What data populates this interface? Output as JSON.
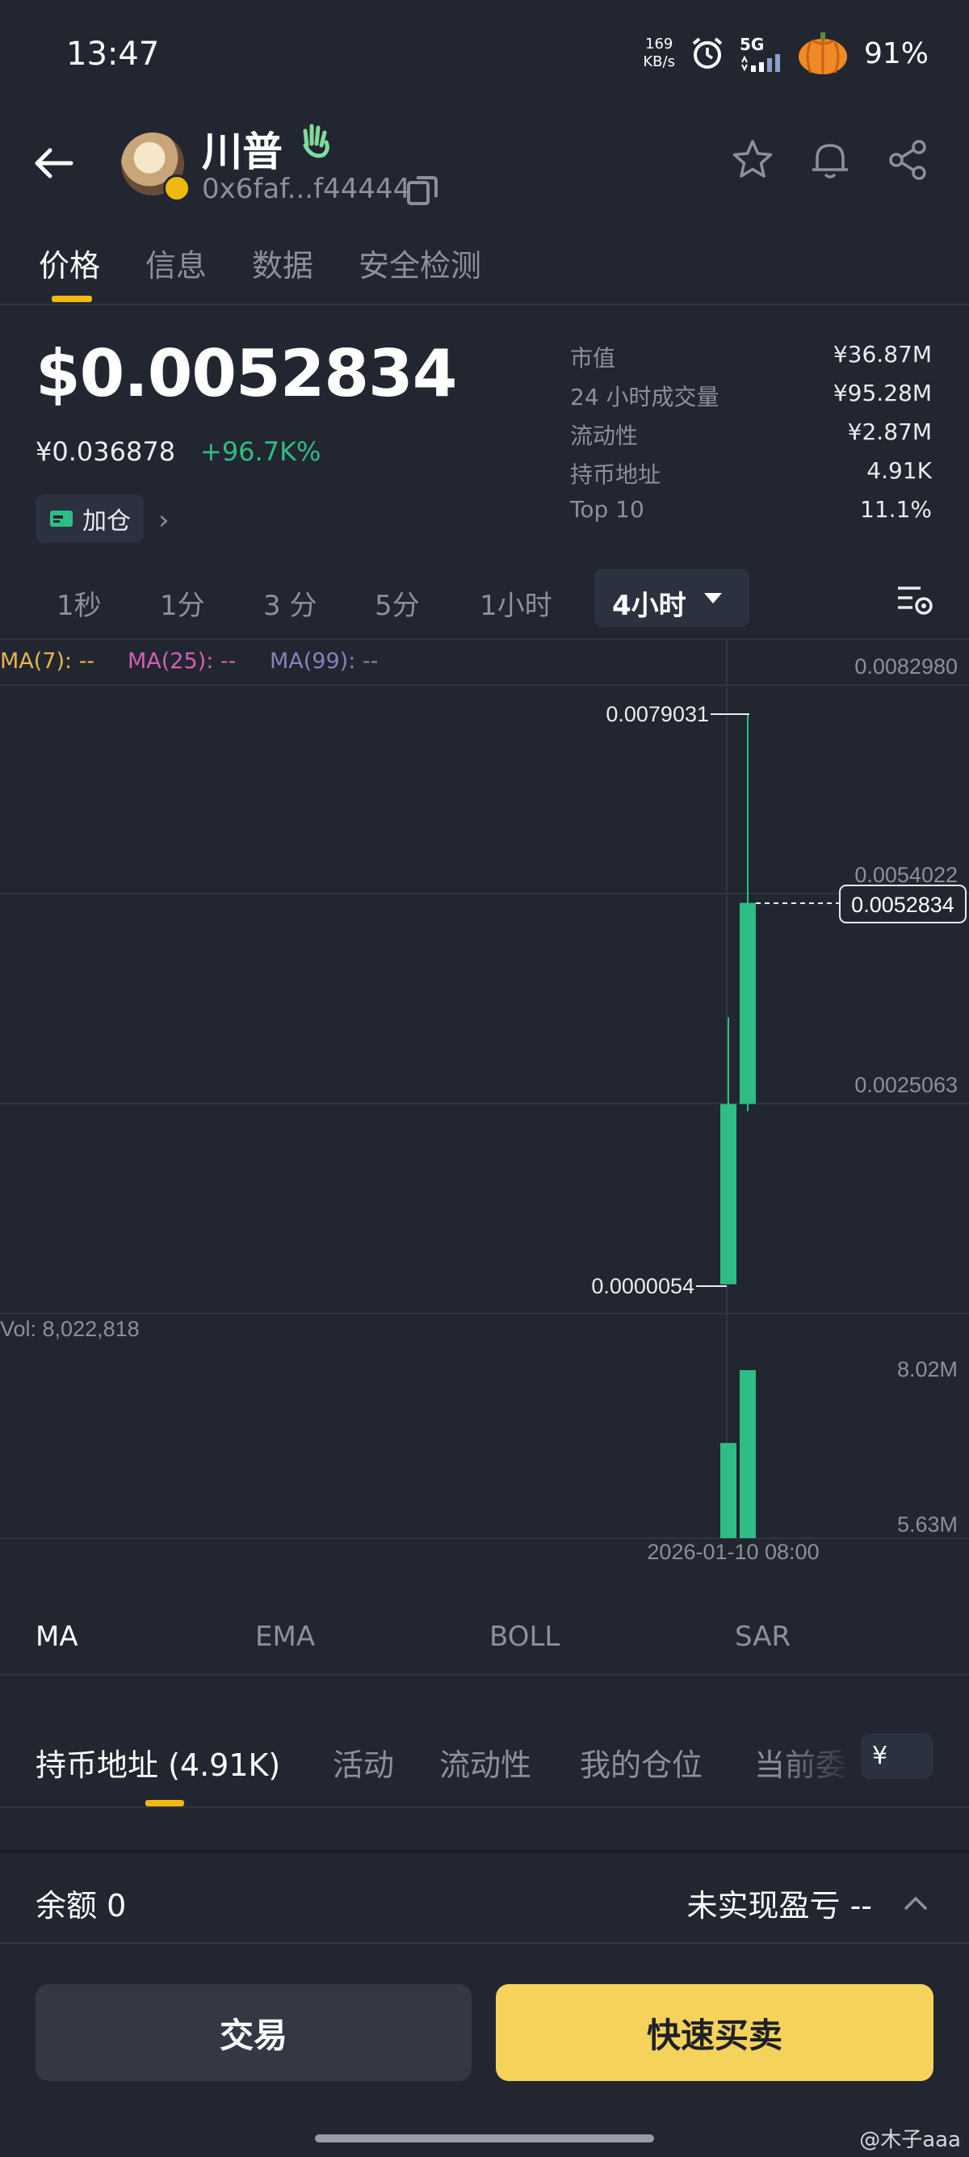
{
  "status_bar": {
    "time": "13:47",
    "speed_value": "169",
    "speed_unit": "KB/s",
    "network": "5G",
    "battery": "91%"
  },
  "header": {
    "token_name": "川普",
    "address": "0x6faf...f44444"
  },
  "tabs": [
    "价格",
    "信息",
    "数据",
    "安全检测"
  ],
  "price": {
    "usd": "$0.0052834",
    "cny": "¥0.036878",
    "change": "+96.7K%",
    "add_position": "加仓"
  },
  "stats": [
    {
      "label": "市值",
      "value": "¥36.87M"
    },
    {
      "label": "24 小时成交量",
      "value": "¥95.28M"
    },
    {
      "label": "流动性",
      "value": "¥2.87M"
    },
    {
      "label": "持币地址",
      "value": "4.91K"
    },
    {
      "label": "Top 10",
      "value": "11.1%"
    }
  ],
  "intervals": [
    "1秒",
    "1分",
    "3 分",
    "5分",
    "1小时"
  ],
  "active_interval": "4小时",
  "ma_legend": {
    "ma7": "MA(7): --",
    "ma25": "MA(25): --",
    "ma99": "MA(99): --"
  },
  "colors": {
    "up": "#2ebd85",
    "accent": "#f0b90b",
    "ma7": "#e8b64a",
    "ma25": "#d45fb4",
    "ma99": "#8a80b8"
  },
  "chart_data": {
    "type": "candlestick",
    "y_ticks": [
      "0.0082980",
      "0.0054022",
      "0.0025063"
    ],
    "current_price_label": "0.0052834",
    "high_label": "0.0079031",
    "low_label": "0.0000054",
    "x_label": "2026-01-10 08:00",
    "candles": [
      {
        "open": 5.4e-06,
        "high": 0.0037,
        "low": 5.4e-06,
        "close": 0.0025
      },
      {
        "open": 0.0025,
        "high": 0.0079031,
        "low": 0.0024,
        "close": 0.0052834
      }
    ],
    "volume_label": "Vol: 8,022,818",
    "volume_ticks": [
      "8.02M",
      "5.63M"
    ],
    "volumes": [
      6900000,
      8022818
    ]
  },
  "indicators": [
    "MA",
    "EMA",
    "BOLL",
    "SAR"
  ],
  "holder_tabs": [
    "持币地址 (4.91K)",
    "活动",
    "流动性",
    "我的仓位",
    "当前委托"
  ],
  "currency_pill": "¥",
  "balance": "余额 0",
  "unrealized_pnl": "未实现盈亏 --",
  "buttons": {
    "trade": "交易",
    "quick": "快速买卖"
  },
  "watermark": "@木子aaa"
}
